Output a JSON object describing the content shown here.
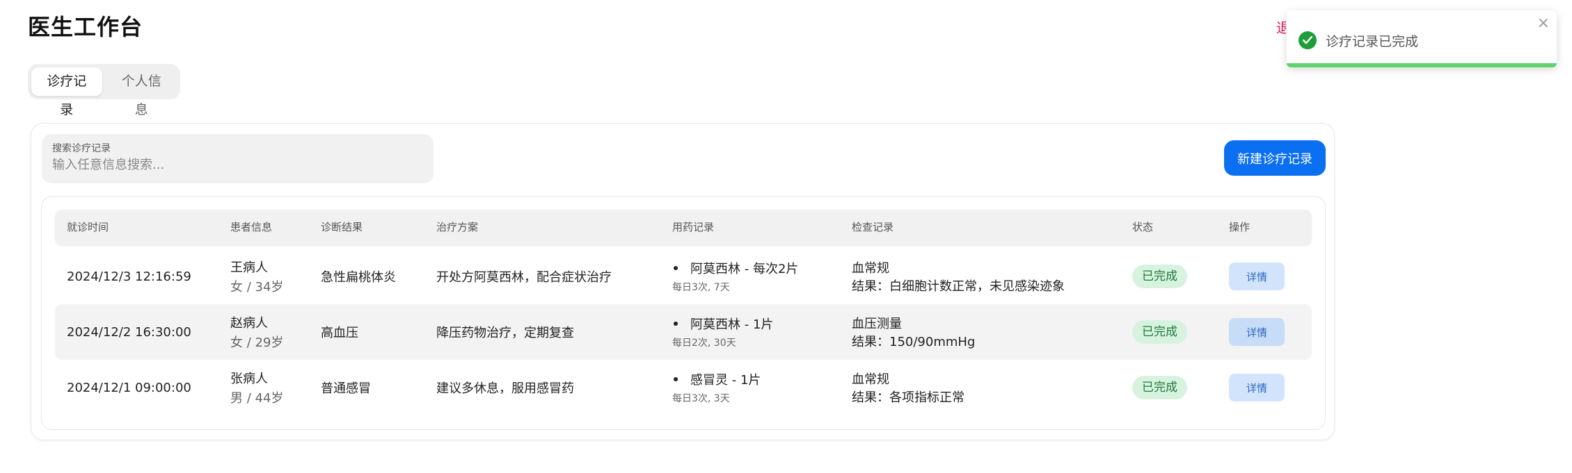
{
  "app": {
    "title": "医生工作台",
    "logout": "退出登录"
  },
  "tabs": [
    {
      "label": "诊疗记录",
      "active": true
    },
    {
      "label": "个人信息",
      "active": false
    }
  ],
  "search": {
    "label": "搜索诊疗记录",
    "placeholder": "输入任意信息搜索...",
    "value": ""
  },
  "new_record_button": "新建诊疗记录",
  "table": {
    "headers": [
      "就诊时间",
      "患者信息",
      "诊断结果",
      "治疗方案",
      "用药记录",
      "检查记录",
      "状态",
      "操作"
    ],
    "rows": [
      {
        "time": "2024/12/3 12:16:59",
        "patient_name": "王病人",
        "patient_meta": "女 / 34岁",
        "diagnosis": "急性扁桃体炎",
        "treatment": "开处方阿莫西林，配合症状治疗",
        "med_name": "阿莫西林 - 每次2片",
        "med_freq": "每日3次, 7天",
        "exam_name": "血常规",
        "exam_result": "结果：白细胞计数正常，未见感染迹象",
        "status": "已完成",
        "action": "详情"
      },
      {
        "time": "2024/12/2 16:30:00",
        "patient_name": "赵病人",
        "patient_meta": "女 / 29岁",
        "diagnosis": "高血压",
        "treatment": "降压药物治疗，定期复查",
        "med_name": "阿莫西林 - 1片",
        "med_freq": "每日2次, 30天",
        "exam_name": "血压测量",
        "exam_result": "结果：150/90mmHg",
        "status": "已完成",
        "action": "详情"
      },
      {
        "time": "2024/12/1 09:00:00",
        "patient_name": "张病人",
        "patient_meta": "男 / 44岁",
        "diagnosis": "普通感冒",
        "treatment": "建议多休息，服用感冒药",
        "med_name": "感冒灵 - 1片",
        "med_freq": "每日3次, 3天",
        "exam_name": "血常规",
        "exam_result": "结果：各项指标正常",
        "status": "已完成",
        "action": "详情"
      }
    ]
  },
  "toast": {
    "message": "诊疗记录已完成",
    "icon": "check-circle-icon",
    "close_icon": "close-icon"
  },
  "colors": {
    "primary": "#0a6ff0",
    "success": "#1e9e3a",
    "danger": "#e3154f"
  }
}
